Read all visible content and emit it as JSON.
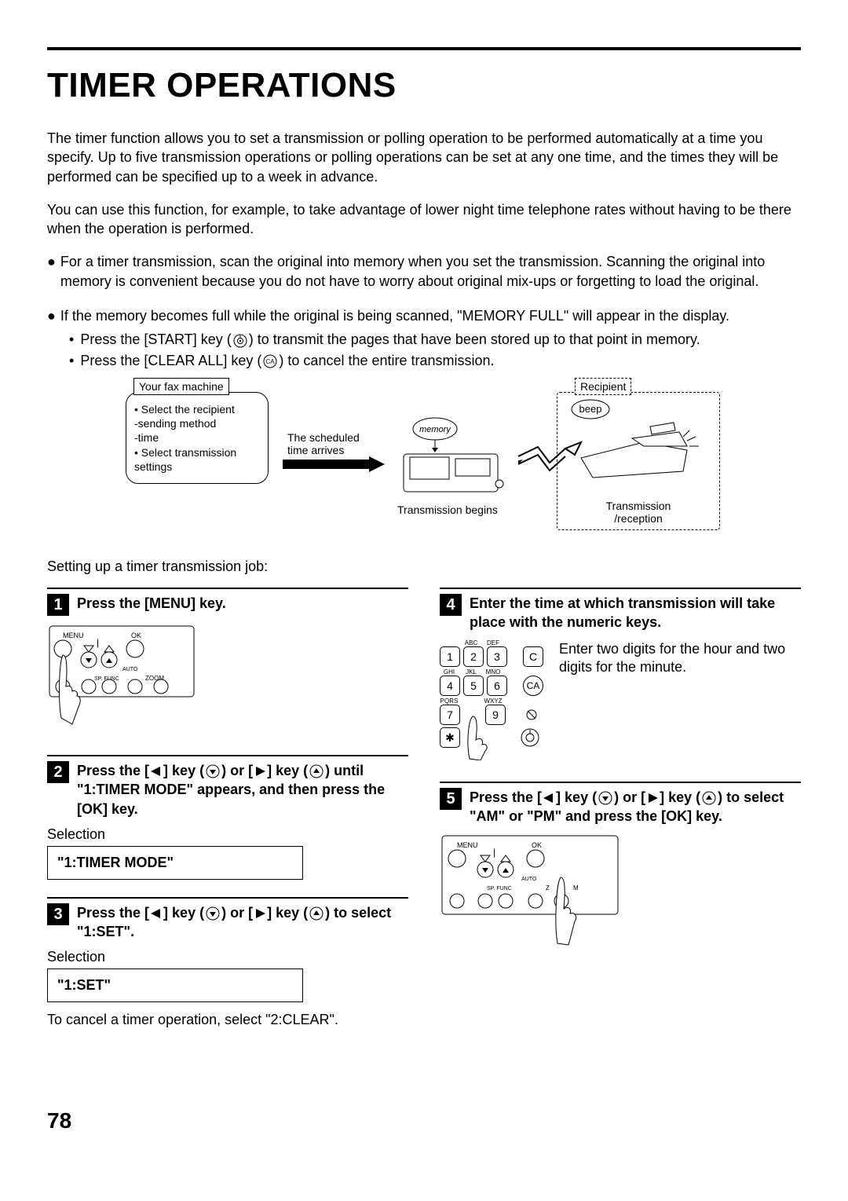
{
  "title": "TIMER OPERATIONS",
  "intro1": "The timer function allows you to set a transmission or polling operation to be performed automatically at a time you specify. Up to five transmission operations or polling operations can be set at any one time, and the times they will be performed can be specified up to a week in advance.",
  "intro2": "You can use this function, for example, to take advantage of lower night time telephone rates without having to be there when the operation is performed.",
  "bullet1": "For a timer transmission, scan the original into memory when you set the transmission. Scanning the original into memory is convenient because you do not have to worry about original mix-ups or forgetting to load the original.",
  "bullet2_intro": "If the memory becomes full while the original is being scanned, \"MEMORY FULL\" will appear in the display.",
  "bullet2_s1_a": "Press the [START] key (",
  "bullet2_s1_b": ") to transmit the pages that have been stored up to that point in memory.",
  "bullet2_s2_a": "Press the [CLEAR ALL] key (",
  "bullet2_s2_b": ") to cancel the entire transmission.",
  "diagram": {
    "yourfax": "Your fax machine",
    "settings": "• Select the recipient\n  -sending method\n  -time\n• Select transmission\n  settings",
    "schedtime": "The scheduled time arrives",
    "memory": "memory",
    "transbegin": "Transmission begins",
    "recipient": "Recipient",
    "beep": "beep",
    "transrecep": "Transmission\n/reception"
  },
  "setupLead": "Setting up a timer transmission job:",
  "steps": {
    "s1": "Press the [MENU] key.",
    "s2_a": "Press the [",
    "s2_b": "] key (",
    "s2_c": ") or [",
    "s2_d": "] key (",
    "s2_e": ") until \"1:TIMER MODE\" appears, and then press the [OK] key.",
    "s2_sel_label": "Selection",
    "s2_sel_box": "\"1:TIMER MODE\"",
    "s3_a": "Press the [",
    "s3_b": "] key (",
    "s3_c": ") or [",
    "s3_d": "] key (",
    "s3_e": ") to select \"1:SET\".",
    "s3_sel_label": "Selection",
    "s3_sel_box": "\"1:SET\"",
    "s3_cancel": "To cancel a timer operation, select \"2:CLEAR\".",
    "s4": "Enter the time at which transmission will take place with the numeric keys.",
    "s4_hint": "Enter two digits for the hour and two digits for the minute.",
    "s5_a": "Press the [",
    "s5_b": "] key (",
    "s5_c": ") or [",
    "s5_d": "] key (",
    "s5_e": ") to select \"AM\" or \"PM\" and press the [OK] key."
  },
  "panelLabels": {
    "menu": "MENU",
    "ok": "OK",
    "auto": "AUTO",
    "zoom": "ZOOM",
    "spfunc": "SP. FUNC"
  },
  "keypad": {
    "r0": [
      "",
      "ABC",
      "DEF"
    ],
    "r1": [
      "1",
      "2",
      "3"
    ],
    "r1l": [
      "GHI",
      "JKL",
      "MNO"
    ],
    "r2": [
      "4",
      "5",
      "6"
    ],
    "r2l": [
      "PQRS",
      "",
      "WXYZ"
    ],
    "r3": [
      "7",
      "",
      "9"
    ],
    "r4": [
      "✱",
      "",
      ""
    ],
    "c": "C",
    "ca": "CA"
  },
  "pageNumber": "78"
}
